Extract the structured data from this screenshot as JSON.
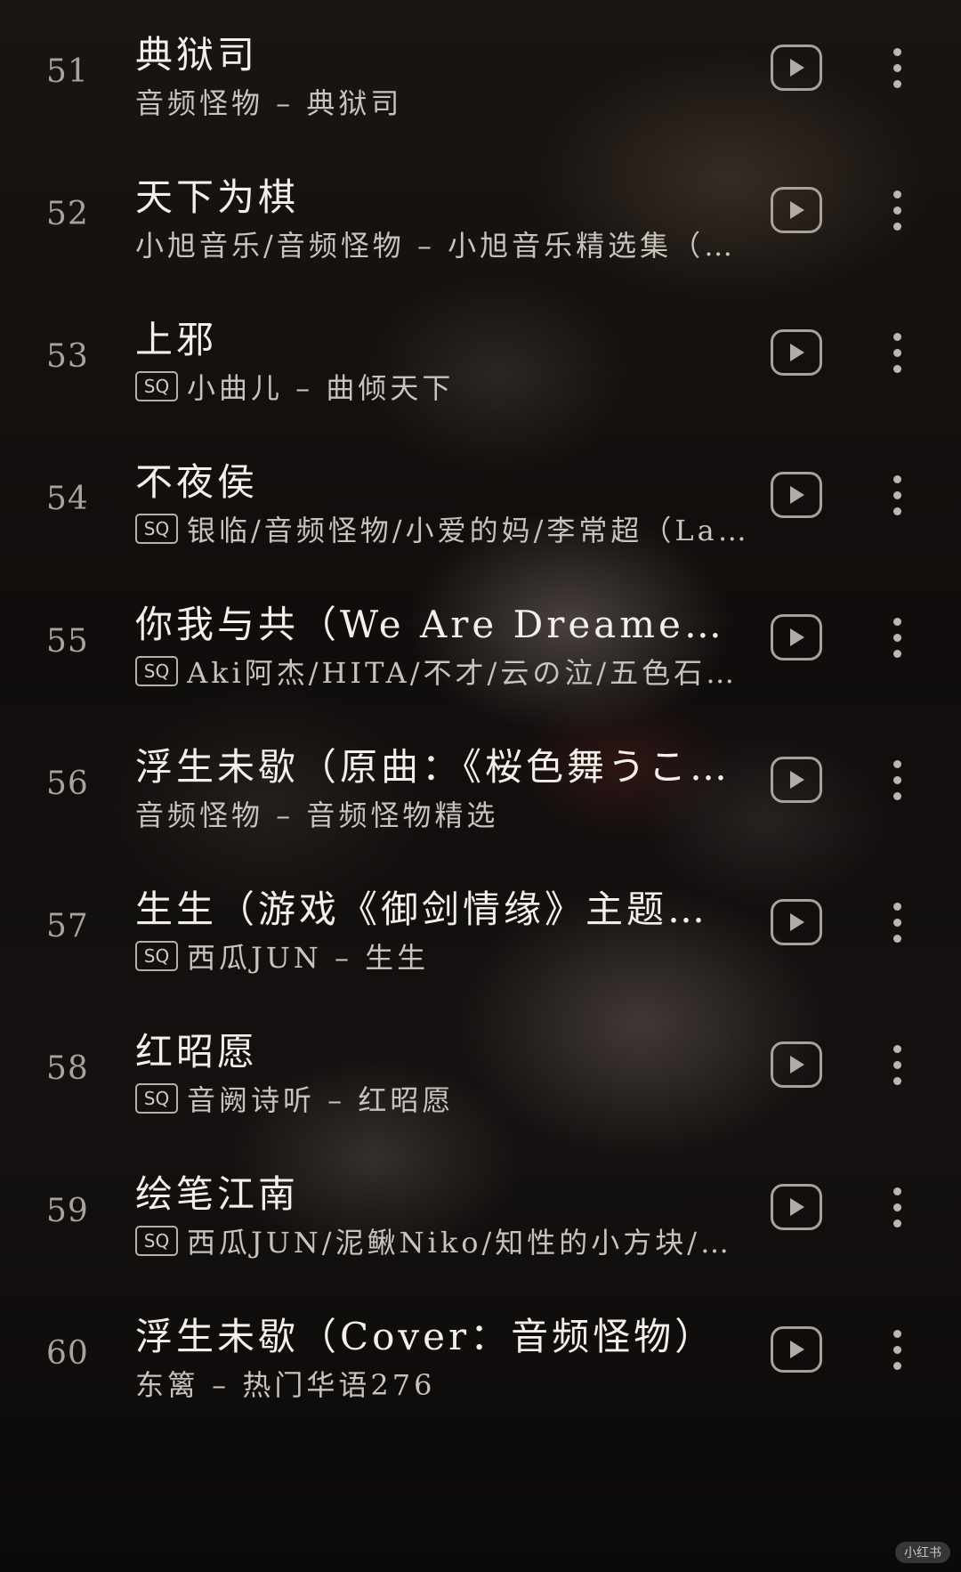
{
  "songs": [
    {
      "index": "51",
      "title": "典狱司",
      "sq": false,
      "subtitle": "音频怪物 – 典狱司"
    },
    {
      "index": "52",
      "title": "天下为棋",
      "sq": false,
      "subtitle": "小旭音乐/音频怪物 – 小旭音乐精选集（…"
    },
    {
      "index": "53",
      "title": "上邪",
      "sq": true,
      "subtitle": "小曲儿 – 曲倾天下"
    },
    {
      "index": "54",
      "title": "不夜侯",
      "sq": true,
      "subtitle": "银临/音频怪物/小爱的妈/李常超（La…"
    },
    {
      "index": "55",
      "title": "你我与共（We Are Dreamers）",
      "sq": true,
      "subtitle": "Aki阿杰/HITA/不才/云の泣/五色石…"
    },
    {
      "index": "56",
      "title": "浮生未歇（原曲：《桜色舞うこ…",
      "sq": false,
      "subtitle": "音频怪物 – 音频怪物精选"
    },
    {
      "index": "57",
      "title": "生生（游戏《御剑情缘》主题歌）",
      "sq": true,
      "subtitle": "西瓜JUN – 生生"
    },
    {
      "index": "58",
      "title": "红昭愿",
      "sq": true,
      "subtitle": "音阙诗听 – 红昭愿"
    },
    {
      "index": "59",
      "title": "绘笔江南",
      "sq": true,
      "subtitle": "西瓜JUN/泥鳅Niko/知性的小方块/叶…"
    },
    {
      "index": "60",
      "title": "浮生未歇（Cover：音频怪物）",
      "sq": false,
      "subtitle": "东篱 – 热门华语276"
    }
  ],
  "badge_text": "SQ",
  "icons": {
    "play": "play-icon",
    "more": "more-vertical-icon"
  },
  "watermark": "小红书"
}
